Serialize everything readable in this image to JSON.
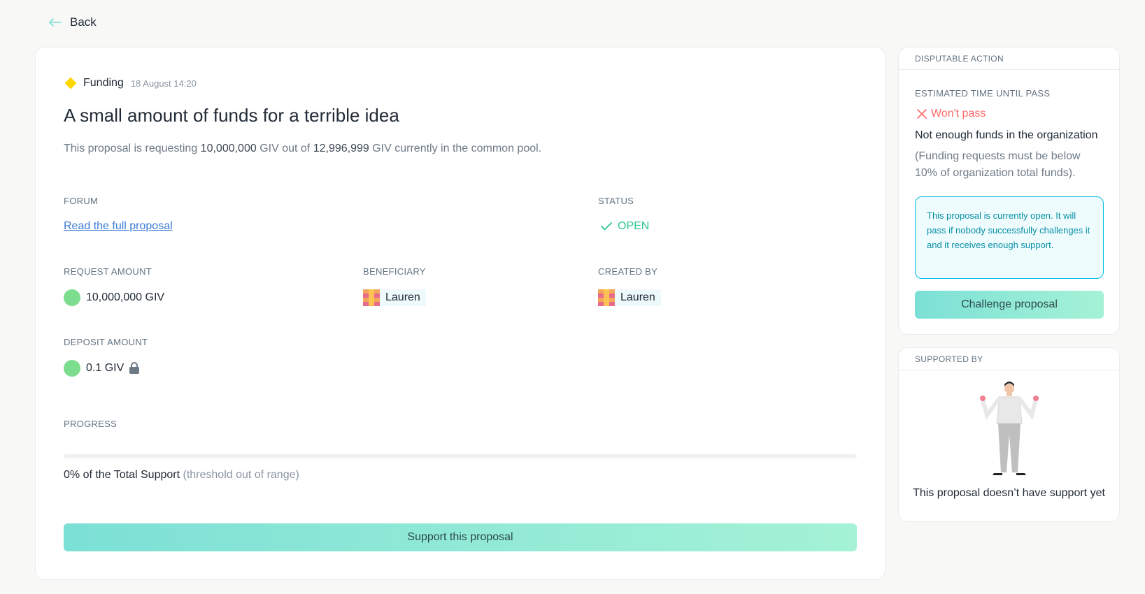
{
  "nav": {
    "back_label": "Back"
  },
  "proposal": {
    "type": "Funding",
    "date": "18 August 14:20",
    "title": "A small amount of funds for a terrible idea",
    "desc_prefix": "This proposal is requesting",
    "desc_amount": "10,000,000",
    "desc_mid": "GIV out of",
    "desc_pool": "12,996,999",
    "desc_suffix": "GIV currently in the common pool.",
    "forum_label": "FORUM",
    "forum_link": "Read the full proposal",
    "status_label": "STATUS",
    "status_value": "OPEN",
    "request_label": "REQUEST AMOUNT",
    "request_value": "10,000,000 GIV",
    "beneficiary_label": "BENEFICIARY",
    "beneficiary_name": "Lauren",
    "created_label": "CREATED BY",
    "created_name": "Lauren",
    "deposit_label": "DEPOSIT AMOUNT",
    "deposit_value": "0.1 GIV",
    "progress_label": "PROGRESS",
    "progress_fraction": 0,
    "progress_text": "0% of the Total Support",
    "progress_note": "(threshold out of range)",
    "support_button": "Support this proposal"
  },
  "disputable": {
    "header": "DISPUTABLE ACTION",
    "eta_label": "ESTIMATED TIME UNTIL PASS",
    "eta_value": "Won't pass",
    "reason": "Not enough funds in the organization",
    "reason_note": "(Funding requests must be below 10% of organization total funds).",
    "info": "This proposal is currently open. It will pass if nobody successfully challenges it and it receives enough support.",
    "challenge_button": "Challenge proposal"
  },
  "supported": {
    "header": "SUPPORTED BY",
    "empty_text": "This proposal doesn’t have support yet"
  },
  "colors": {
    "accent": "#7ce0d6",
    "status_open": "#2cc68f",
    "wont_pass": "#ff6969",
    "token": "#7ddd8e",
    "funding": "#ffd700"
  }
}
